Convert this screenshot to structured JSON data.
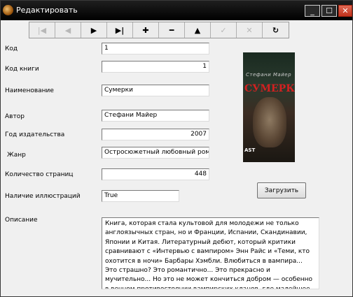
{
  "window": {
    "title": "Редактировать"
  },
  "toolbar": {
    "buttons": [
      {
        "glyph": "|◀",
        "name": "first-record"
      },
      {
        "glyph": "◀",
        "name": "prior-record"
      },
      {
        "glyph": "▶",
        "name": "next-record"
      },
      {
        "glyph": "▶|",
        "name": "last-record"
      },
      {
        "glyph": "✚",
        "name": "insert-record"
      },
      {
        "glyph": "━",
        "name": "delete-record"
      },
      {
        "glyph": "▲",
        "name": "edit-record"
      },
      {
        "glyph": "✓",
        "name": "post-record"
      },
      {
        "glyph": "✕",
        "name": "cancel-record"
      },
      {
        "glyph": "↻",
        "name": "refresh-record"
      }
    ]
  },
  "form": {
    "kod": {
      "label": "Код",
      "value": "1"
    },
    "kod_knigi": {
      "label": "Код книги",
      "value": "1"
    },
    "naimenovanie": {
      "label": "Наименование",
      "value": "Сумерки"
    },
    "avtor": {
      "label": "Автор",
      "value": "Стефани Майер"
    },
    "god": {
      "label": "Год издательства",
      "value": "2007"
    },
    "zhanr": {
      "label": "Жанр",
      "value": "Остросюжетный любовный роман"
    },
    "stranic": {
      "label": "Количество страниц",
      "value": "448"
    },
    "illyustracii": {
      "label": "Наличие иллюстраций",
      "value": "True"
    },
    "opisanie": {
      "label": "Описание",
      "value": "Книга, которая стала культовой для молодежи не только англоязычных стран, но и Франции, Испании, Скандинавии, Японии и Китая. Литературный дебют, который критики сравнивают с «Интервью с вампиром» Энн Райс и «Теми, кто охотится в ночи» Барбары Хэмбли. Влюбиться в вампира... Это страшно? Это романтично... Это прекрасно и мучительно... Но это не может кончиться добром — особенно в вечном противостоянии вампирских кланов, где малейшее отличие от"
    }
  },
  "cover": {
    "author": "Стефани Майер",
    "title": "СУМЕРКИ",
    "publisher": "AST"
  },
  "upload_label": "Загрузить"
}
